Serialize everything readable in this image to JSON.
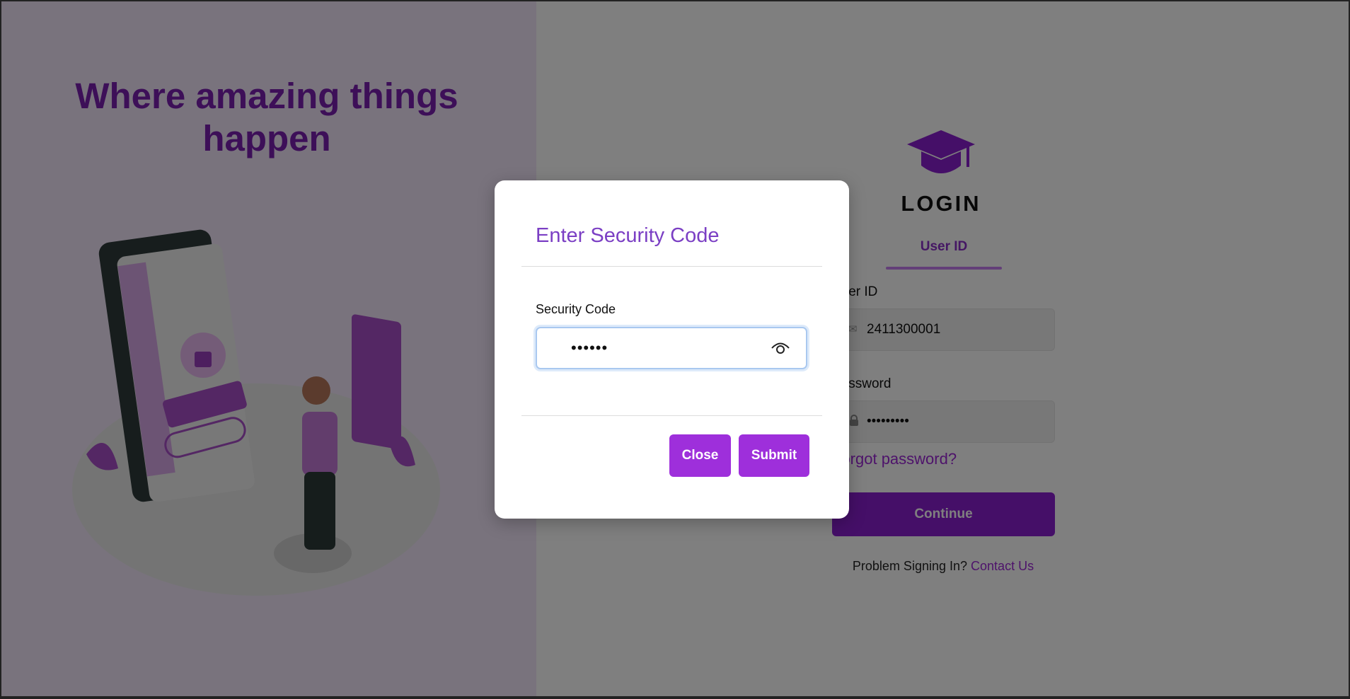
{
  "left": {
    "headline_line1": "Where amazing things",
    "headline_line2": "happen"
  },
  "login": {
    "title": "LOGIN",
    "tab_label": "User ID",
    "userid_label": "User ID",
    "userid_value": "2411300001",
    "password_label": "Password",
    "password_value": "•••••••••",
    "forgot_label": "Forgot password?",
    "continue_label": "Continue",
    "problem_text": "Problem Signing In?",
    "contact_link": "Contact Us"
  },
  "modal": {
    "title": "Enter Security Code",
    "field_label": "Security Code",
    "field_value": "••••••",
    "close_label": "Close",
    "submit_label": "Submit"
  },
  "icons": {
    "cap": "graduation-cap-icon",
    "user": "mail-icon",
    "password": "lock-icon",
    "toggle": "eye-icon"
  },
  "colors": {
    "brand": "#8a1fd0",
    "button": "#9e2fdb",
    "title": "#7b3fc4"
  }
}
